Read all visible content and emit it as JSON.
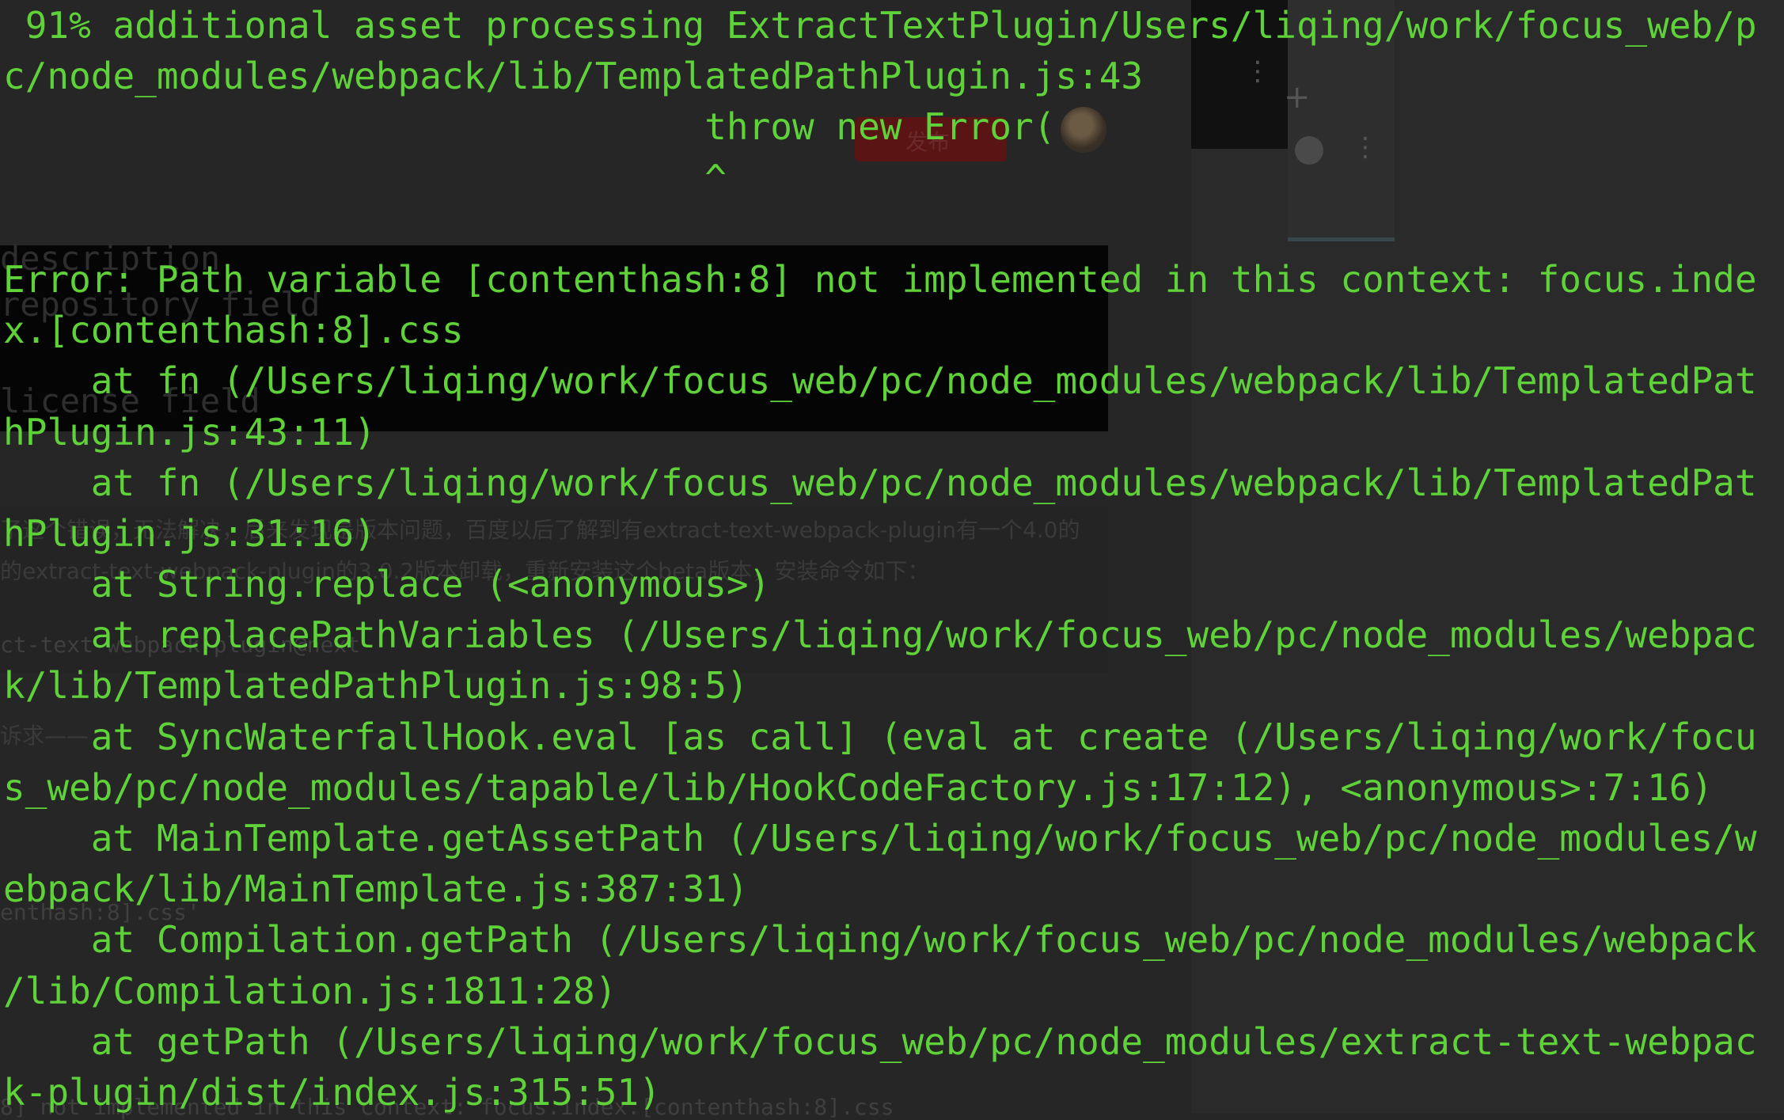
{
  "terminal": {
    "text_color": "#5fd23a",
    "background_color": "#262626",
    "lines": [
      " 91% additional asset processing ExtractTextPlugin/Users/liqing/work/focus_web/p",
      "c/node_modules/webpack/lib/TemplatedPathPlugin.js:43",
      "                                throw new Error(",
      "                                ^",
      "",
      "Error: Path variable [contenthash:8] not implemented in this context: focus.inde",
      "x.[contenthash:8].css",
      "    at fn (/Users/liqing/work/focus_web/pc/node_modules/webpack/lib/TemplatedPat",
      "hPlugin.js:43:11)",
      "    at fn (/Users/liqing/work/focus_web/pc/node_modules/webpack/lib/TemplatedPat",
      "hPlugin.js:31:16)",
      "    at String.replace (<anonymous>)",
      "    at replacePathVariables (/Users/liqing/work/focus_web/pc/node_modules/webpac",
      "k/lib/TemplatedPathPlugin.js:98:5)",
      "    at SyncWaterfallHook.eval [as call] (eval at create (/Users/liqing/work/focu",
      "s_web/pc/node_modules/tapable/lib/HookCodeFactory.js:17:12), <anonymous>:7:16)",
      "    at MainTemplate.getAssetPath (/Users/liqing/work/focus_web/pc/node_modules/w",
      "ebpack/lib/MainTemplate.js:387:31)",
      "    at Compilation.getPath (/Users/liqing/work/focus_web/pc/node_modules/webpack",
      "/lib/Compilation.js:1811:28)",
      "    at getPath (/Users/liqing/work/focus_web/pc/node_modules/extract-text-webpac",
      "k-plugin/dist/index.js:315:51)"
    ]
  },
  "background_page": {
    "button_label": "发布",
    "ghost_fields": [
      "description",
      "repository field",
      "license field"
    ],
    "paragraph_lines": [
      "了这个错误，无法解决，后来发现是版本问题，百度以后了解到有extract-text-webpack-plugin有一个4.0的",
      "的extract-text-webpack-plugin的3.0.2版本卸载，重新安装这个beta版本，安装命令如下："
    ],
    "code_line": "ct-text-webpack-plugin@next",
    "section_line": "诉求——",
    "css_snippet": "enthash:8].css'",
    "bottom_line": "8] not implemented in this context: focus.index.[contenthash:8].css"
  }
}
